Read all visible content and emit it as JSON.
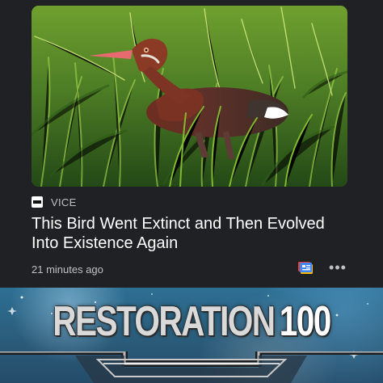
{
  "card": {
    "source": {
      "logo_icon": "vice-logo-icon",
      "name": "VICE"
    },
    "headline": "This Bird Went Extinct and Then Evolved Into Existence Again",
    "timestamp": "21 minutes ago",
    "save_icon": "google-news-save-icon",
    "more_icon": "more-horizontal-icon",
    "colors": {
      "background": "#202124",
      "headline": "#ffffff",
      "muted_text": "#bdc1c6"
    }
  },
  "meme": {
    "title_main": "RESTORATION",
    "title_suffix": "100",
    "frame_icon": "skyrim-skill-frame-icon",
    "colors": {
      "sky": "#2d6f94",
      "text": "#d9d9d9"
    }
  }
}
